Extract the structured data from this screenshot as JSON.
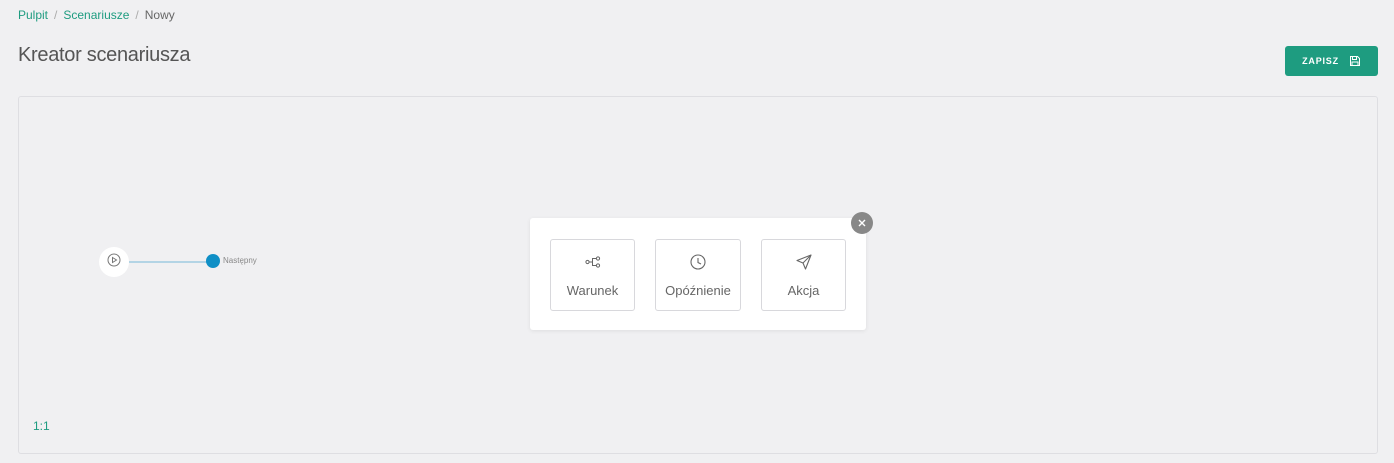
{
  "breadcrumb": {
    "items": [
      "Pulpit",
      "Scenariusze"
    ],
    "current": "Nowy",
    "separator": "/"
  },
  "page": {
    "title": "Kreator scenariusza"
  },
  "toolbar": {
    "save_label": "ZAPISZ",
    "save_icon": "floppy-disk-icon"
  },
  "canvas": {
    "zoom_label": "1:1",
    "start_node_icon": "play-circle-icon",
    "next_label": "Następny"
  },
  "popup": {
    "close_icon": "close-icon",
    "options": [
      {
        "label": "Warunek",
        "icon": "branch-icon"
      },
      {
        "label": "Opóźnienie",
        "icon": "clock-icon"
      },
      {
        "label": "Akcja",
        "icon": "send-icon"
      }
    ]
  },
  "colors": {
    "accent": "#1e9c80",
    "handle": "#0f8fc6",
    "background": "#f0f0f2"
  }
}
